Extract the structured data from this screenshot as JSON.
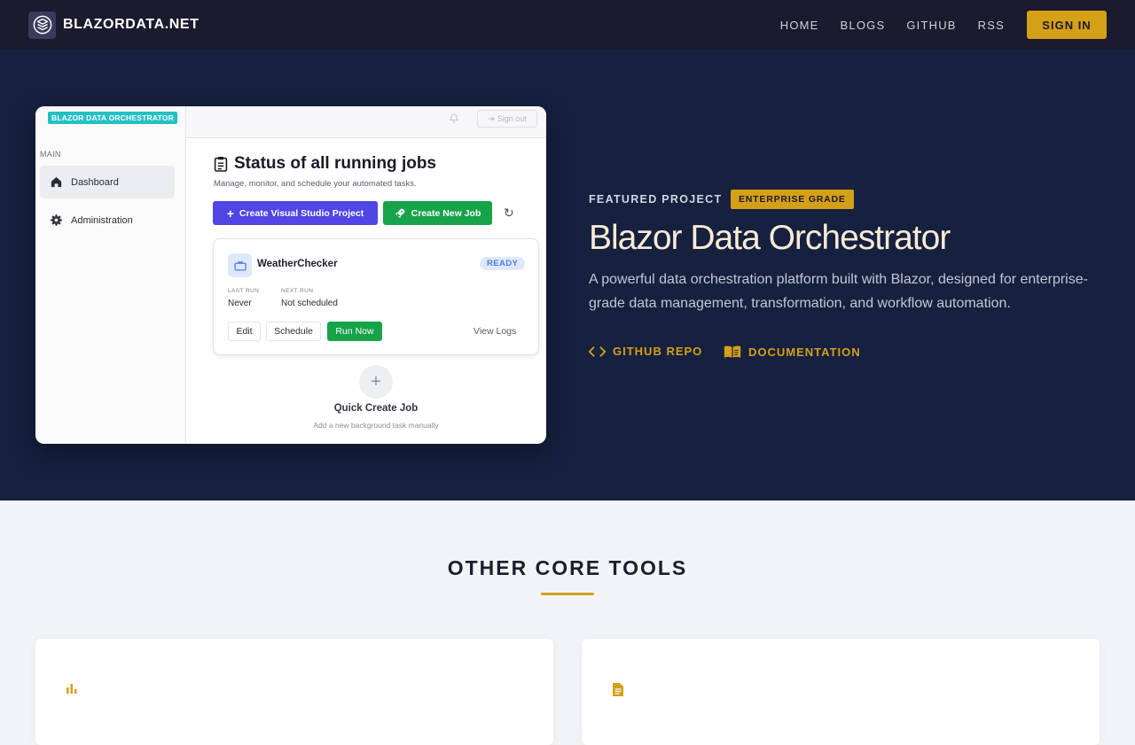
{
  "nav": {
    "brand": "BLAZORDATA.NET",
    "links": [
      "HOME",
      "BLOGS",
      "GITHUB",
      "RSS"
    ],
    "signin": "SIGN IN"
  },
  "hero": {
    "mock": {
      "badge": "BLAZOR DATA ORCHESTRATOR",
      "signout": "Sign out",
      "section": "MAIN",
      "nav_items": [
        "Dashboard",
        "Administration"
      ],
      "title": "Status of all running jobs",
      "subtitle": "Manage, monitor, and schedule your automated tasks.",
      "btn_create_project": "Create Visual Studio Project",
      "btn_create_job": "Create New Job",
      "job": {
        "name": "WeatherChecker",
        "status": "READY",
        "last_run_label": "LAST RUN",
        "last_run_value": "Never",
        "next_run_label": "NEXT RUN",
        "next_run_value": "Not scheduled",
        "btn_edit": "Edit",
        "btn_schedule": "Schedule",
        "btn_run": "Run Now",
        "view_logs": "View Logs"
      },
      "quick_create": "Quick Create Job",
      "quick_create_sub": "Add a new background task manually"
    },
    "featured_label": "FEATURED PROJECT",
    "featured_badge": "ENTERPRISE GRADE",
    "title": "Blazor Data Orchestrator",
    "description": "A powerful data orchestration platform built with Blazor, designed for enterprise-grade data management, transformation, and workflow automation.",
    "link_github": "GITHUB REPO",
    "link_docs": "DOCUMENTATION"
  },
  "tools": {
    "title": "OTHER CORE TOOLS",
    "cards": [
      {
        "icon": "bar-chart-icon"
      },
      {
        "icon": "document-icon"
      }
    ]
  },
  "colors": {
    "navbar": "#1b1a2e",
    "hero": "#16203f",
    "accent": "#d4a017",
    "title": "#f8ebd3"
  }
}
